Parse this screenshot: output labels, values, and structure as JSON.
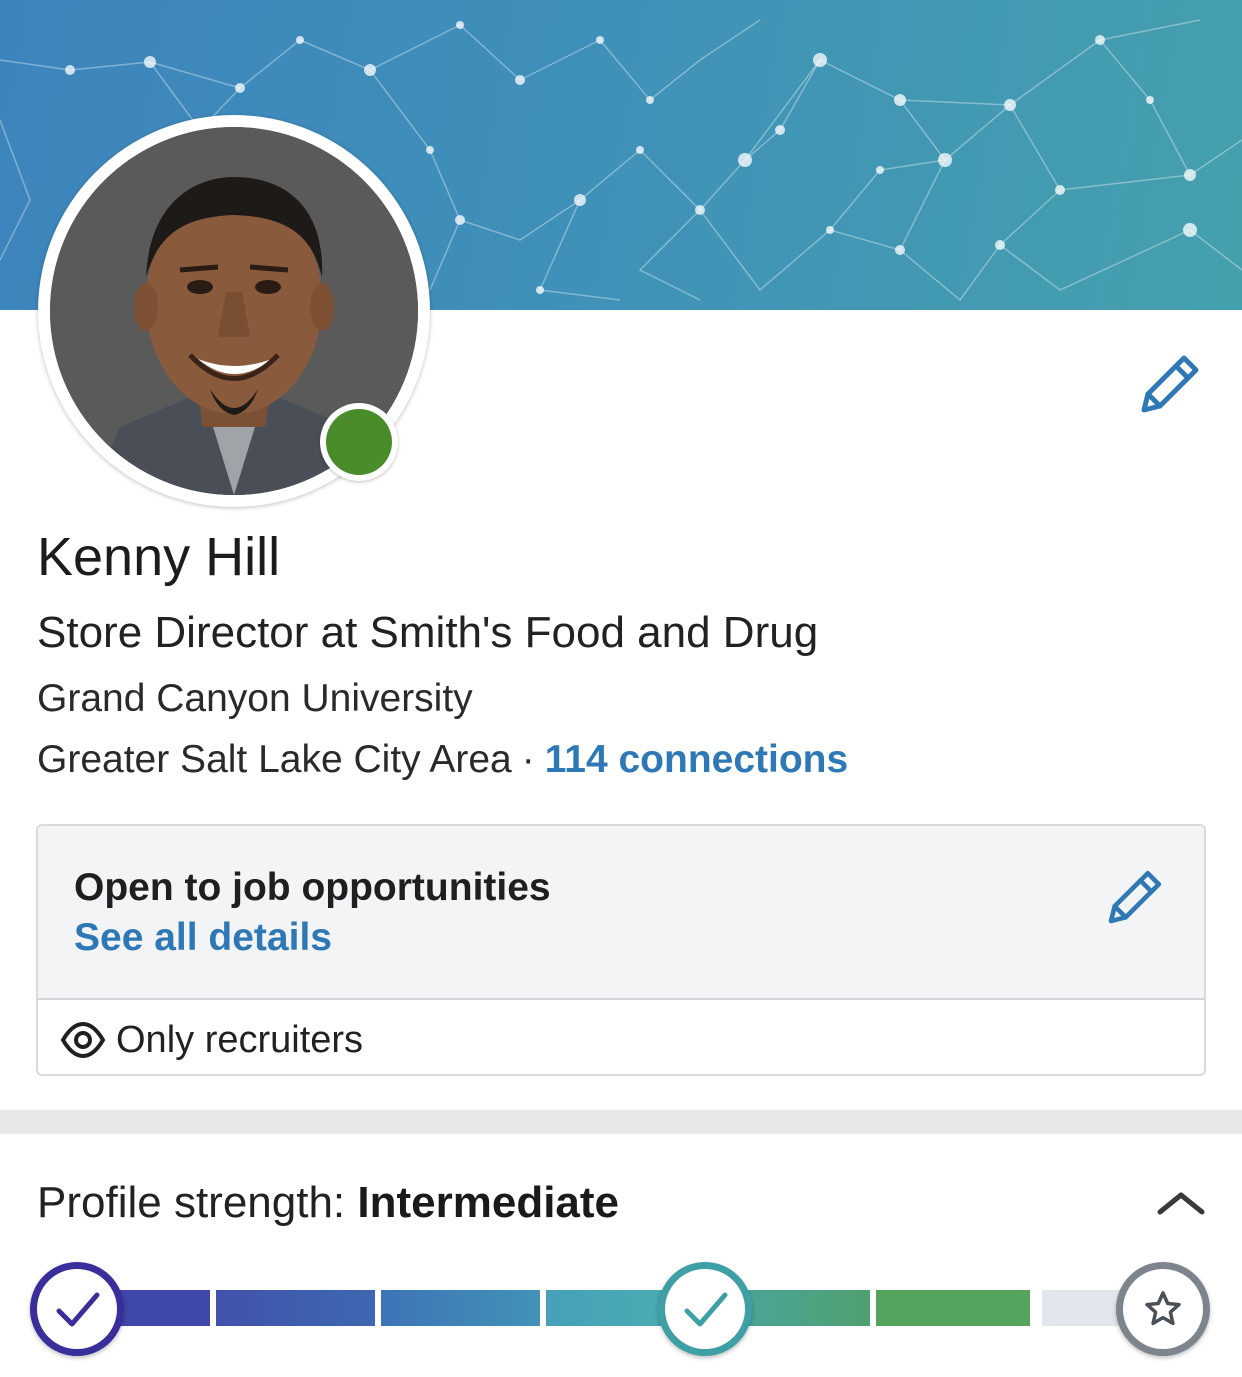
{
  "profile": {
    "name": "Kenny Hill",
    "headline": "Store Director at Smith's Food and Drug",
    "school": "Grand Canyon University",
    "location": "Greater Salt Lake City Area",
    "separator": "·",
    "connections": "114 connections",
    "online": true
  },
  "open_to_jobs": {
    "title": "Open to job opportunities",
    "link": "See all details",
    "visibility": "Only recruiters"
  },
  "profile_strength": {
    "label": "Profile strength:",
    "level": "Intermediate",
    "levels_completed": 2,
    "levels_total": 3
  },
  "colors": {
    "accent_link": "#2e78b5",
    "presence_green": "#4a8c2a",
    "banner_start": "#3d84bd",
    "banner_end": "#45a0ad"
  },
  "icons": {
    "edit_intro": "pencil-icon",
    "edit_open_to_jobs": "pencil-icon",
    "visibility": "eye-icon",
    "collapse": "chevron-up-icon",
    "meter_start": "check-icon",
    "meter_middle": "check-icon",
    "meter_end": "star-icon"
  }
}
